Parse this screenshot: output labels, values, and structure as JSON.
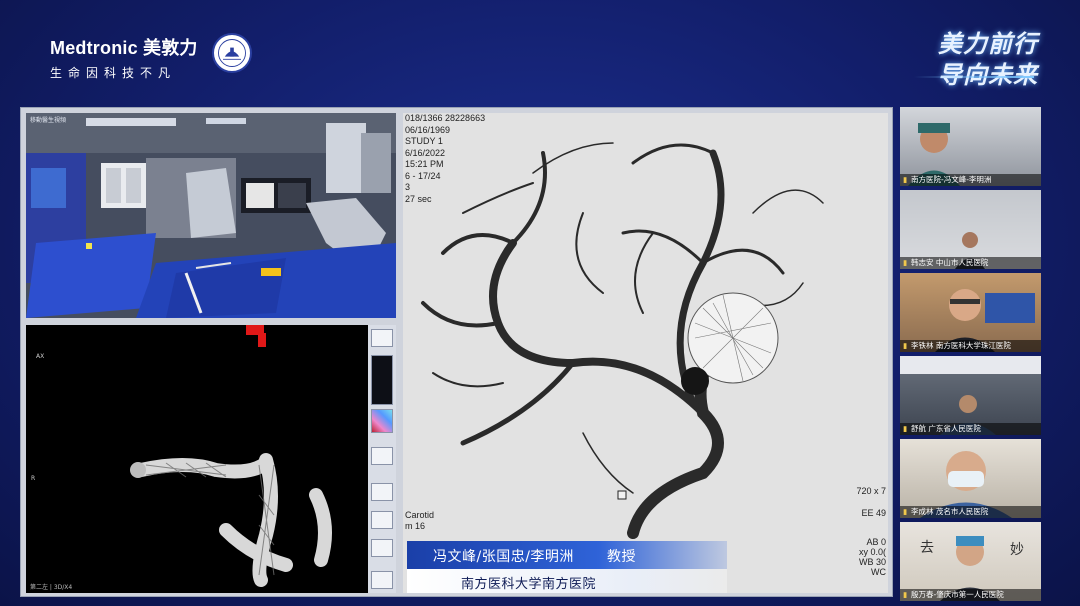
{
  "header": {
    "brand_name": "Medtronic 美敦力",
    "brand_tagline": "生命因科技不凡",
    "slogan_line1": "美力前行",
    "slogan_line2": "导向未来"
  },
  "colors": {
    "background": "#121e6a",
    "caption_blue": "#2f63d8",
    "caption_text_dark": "#0e1b55"
  },
  "or_camera": {
    "label": "移動醫生視頻"
  },
  "recon": {
    "orientation_top": "AX",
    "orientation_side": "R",
    "status": "第二左 | 3D/X4"
  },
  "dsa": {
    "meta_lines": [
      "018/1366 28228663",
      "06/16/1969",
      "",
      "STUDY 1",
      "6/16/2022",
      "15:21 PM",
      "6 - 17/24",
      "3",
      "27 sec"
    ],
    "left_lines": [
      "Carotid",
      "m 16"
    ],
    "right_top": "720 x 7",
    "right_ee": "EE 49",
    "right_lines": [
      "AB 0",
      "xy 0.0(",
      "WB 30",
      "WC"
    ]
  },
  "caption": {
    "names": "冯文峰/张国忠/李明洲",
    "title": "教授",
    "organization": "南方医科大学南方医院"
  },
  "participants": [
    {
      "label": "南方医院-冯文峰-李明洲"
    },
    {
      "label": "韩志安 中山市人民医院"
    },
    {
      "label": "李铁林 南方医科大学珠江医院"
    },
    {
      "label": "舒航 广东省人民医院"
    },
    {
      "label": "李成林 茂名市人民医院"
    },
    {
      "label": "殷万春-肇庆市第一人民医院"
    }
  ]
}
